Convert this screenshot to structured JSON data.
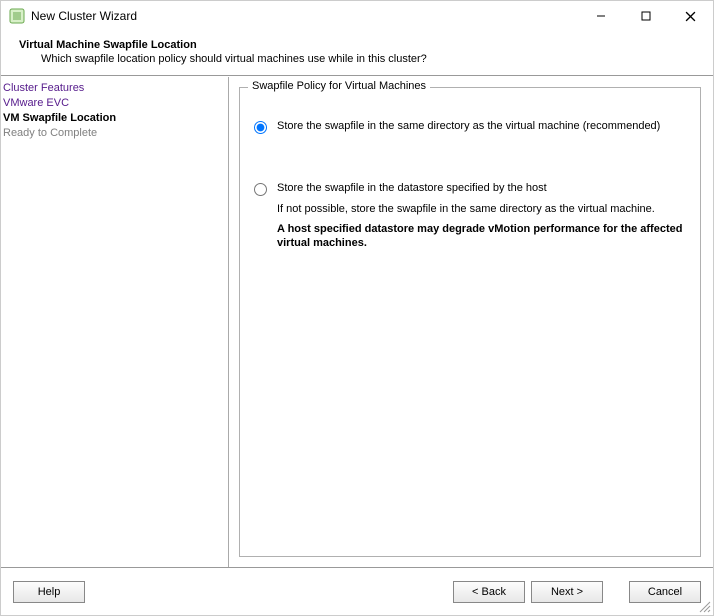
{
  "window": {
    "title": "New Cluster Wizard"
  },
  "header": {
    "title": "Virtual Machine Swapfile Location",
    "subtitle": "Which swapfile location policy should virtual machines use while in this cluster?"
  },
  "sidebar": {
    "items": [
      {
        "label": "Cluster Features"
      },
      {
        "label": "VMware EVC"
      },
      {
        "label": "VM Swapfile Location"
      },
      {
        "label": "Ready to Complete"
      }
    ]
  },
  "group": {
    "title": "Swapfile Policy for Virtual Machines",
    "option1": "Store the swapfile in the same directory as the virtual machine (recommended)",
    "option2": "Store the swapfile in the datastore specified by the host",
    "option2_sub": "If not possible, store the swapfile in the same directory as the virtual machine.",
    "option2_warn": "A host specified datastore may degrade vMotion performance for the affected virtual machines."
  },
  "footer": {
    "help": "Help",
    "back": "< Back",
    "next": "Next >",
    "cancel": "Cancel"
  }
}
